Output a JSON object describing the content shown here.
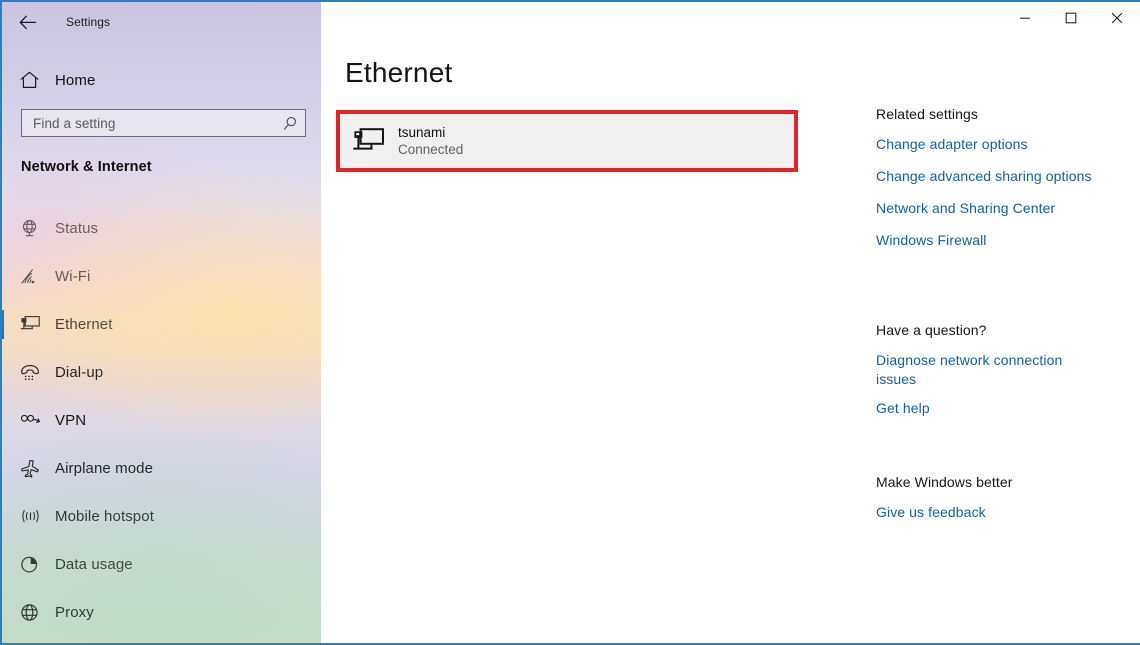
{
  "window": {
    "app_title": "Settings",
    "back_icon": "back-arrow-icon",
    "controls": {
      "minimize": "minimize-icon",
      "maximize": "maximize-icon",
      "close": "close-icon"
    },
    "border_color": "#2680c2"
  },
  "sidebar": {
    "home": {
      "label": "Home",
      "icon": "home-icon"
    },
    "search": {
      "placeholder": "Find a setting",
      "value": "",
      "icon": "search-icon"
    },
    "section_title": "Network & Internet",
    "selected": "Ethernet",
    "accent_color": "#0a6cbd",
    "items": [
      {
        "label": "Status",
        "icon": "globe-monitor-icon",
        "selected": false
      },
      {
        "label": "Wi-Fi",
        "icon": "wifi-icon",
        "selected": false
      },
      {
        "label": "Ethernet",
        "icon": "ethernet-icon",
        "selected": true
      },
      {
        "label": "Dial-up",
        "icon": "dialup-phone-icon",
        "selected": false
      },
      {
        "label": "VPN",
        "icon": "vpn-icon",
        "selected": false
      },
      {
        "label": "Airplane mode",
        "icon": "airplane-icon",
        "selected": false
      },
      {
        "label": "Mobile hotspot",
        "icon": "hotspot-icon",
        "selected": false
      },
      {
        "label": "Data usage",
        "icon": "pie-chart-icon",
        "selected": false
      },
      {
        "label": "Proxy",
        "icon": "globe-icon",
        "selected": false
      }
    ]
  },
  "main": {
    "page_title": "Ethernet",
    "adapter": {
      "name": "tsunami",
      "status": "Connected",
      "icon": "ethernet-connection-icon"
    },
    "highlight_color": "#e1232b"
  },
  "rail": {
    "related": {
      "heading": "Related settings",
      "links": [
        "Change adapter options",
        "Change advanced sharing options",
        "Network and Sharing Center",
        "Windows Firewall"
      ]
    },
    "question": {
      "heading": "Have a question?",
      "links": [
        "Diagnose network connection issues",
        "Get help"
      ]
    },
    "better": {
      "heading": "Make Windows better",
      "links": [
        "Give us feedback"
      ]
    },
    "link_color": "#15609f"
  }
}
